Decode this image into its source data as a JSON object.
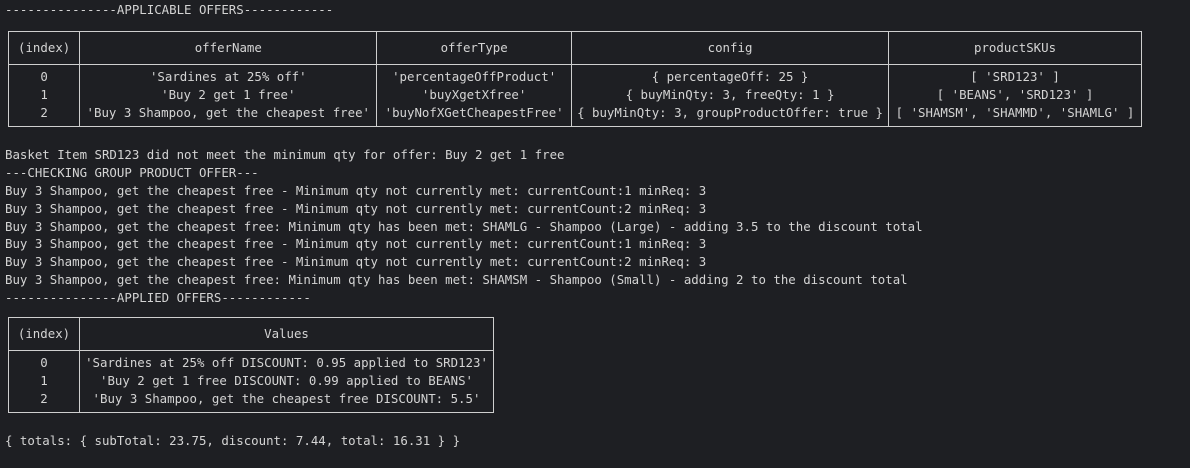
{
  "header_applicable": "---------------APPLICABLE OFFERS------------",
  "offers_table": {
    "columns": [
      "(index)",
      "offerName",
      "offerType",
      "config",
      "productSKUs"
    ],
    "rows": [
      [
        "0",
        "'Sardines at 25% off'",
        "'percentageOffProduct'",
        "{ percentageOff: 25 }",
        "[ 'SRD123' ]"
      ],
      [
        "1",
        "'Buy 2 get 1 free'",
        "'buyXgetXfree'",
        "{ buyMinQty: 3, freeQty: 1 }",
        "[ 'BEANS', 'SRD123' ]"
      ],
      [
        "2",
        "'Buy 3 Shampoo, get the cheapest free'",
        "'buyNofXGetCheapestFree'",
        "{ buyMinQty: 3, groupProductOffer: true }",
        "[ 'SHAMSM', 'SHAMMD', 'SHAMLG' ]"
      ]
    ]
  },
  "log_lines": [
    "Basket Item SRD123 did not meet the minimum qty for offer: Buy 2 get 1 free",
    "---CHECKING GROUP PRODUCT OFFER---",
    "Buy 3 Shampoo, get the cheapest free - Minimum qty not currently met: currentCount:1 minReq: 3",
    "Buy 3 Shampoo, get the cheapest free - Minimum qty not currently met: currentCount:2 minReq: 3",
    "Buy 3 Shampoo, get the cheapest free: Minimum qty has been met: SHAMLG - Shampoo (Large) - adding 3.5 to the discount total",
    "Buy 3 Shampoo, get the cheapest free - Minimum qty not currently met: currentCount:1 minReq: 3",
    "Buy 3 Shampoo, get the cheapest free - Minimum qty not currently met: currentCount:2 minReq: 3",
    "Buy 3 Shampoo, get the cheapest free: Minimum qty has been met: SHAMSM - Shampoo (Small) - adding 2 to the discount total",
    "---------------APPLIED OFFERS------------"
  ],
  "applied_table": {
    "columns": [
      "(index)",
      "Values"
    ],
    "rows": [
      [
        "0",
        "'Sardines at 25% off DISCOUNT: 0.95 applied to SRD123'"
      ],
      [
        "1",
        "'Buy 2 get 1 free DISCOUNT: 0.99 applied to BEANS'"
      ],
      [
        "2",
        "'Buy 3 Shampoo, get the cheapest free DISCOUNT: 5.5'"
      ]
    ]
  },
  "totals_line": "{ totals: { subTotal: 23.75, discount: 7.44, total: 16.31 } }"
}
